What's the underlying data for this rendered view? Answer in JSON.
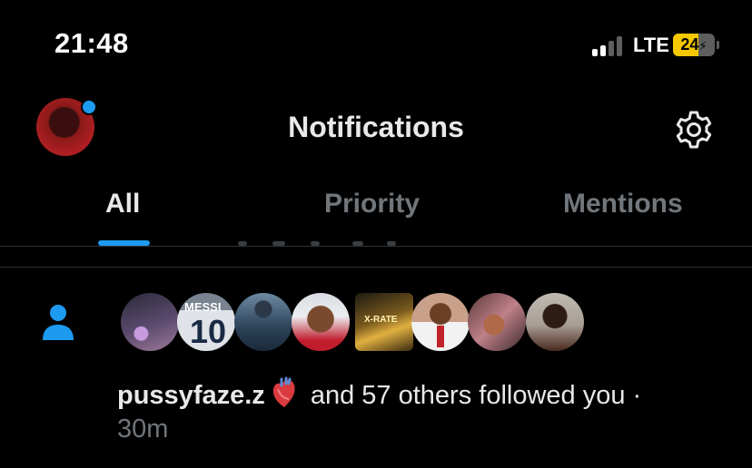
{
  "status_bar": {
    "time": "21:48",
    "network": "LTE",
    "battery": "24",
    "battery_color": "#f5c800",
    "signal_bars_active": 2,
    "signal_bars_total": 4
  },
  "header": {
    "title": "Notifications",
    "avatar_badge_color": "#1d9bf0",
    "settings_icon": "gear-icon"
  },
  "tabs": [
    {
      "label": "All",
      "active": true
    },
    {
      "label": "Priority",
      "active": false
    },
    {
      "label": "Mentions",
      "active": false
    }
  ],
  "accent_color": "#1d9bf0",
  "notification": {
    "type_icon": "person-icon",
    "avatar_count": 8,
    "username": "pussyfaze.z",
    "emoji": "anatomical-heart-emoji",
    "message": " and 57 others followed you ·",
    "time": "30m"
  }
}
